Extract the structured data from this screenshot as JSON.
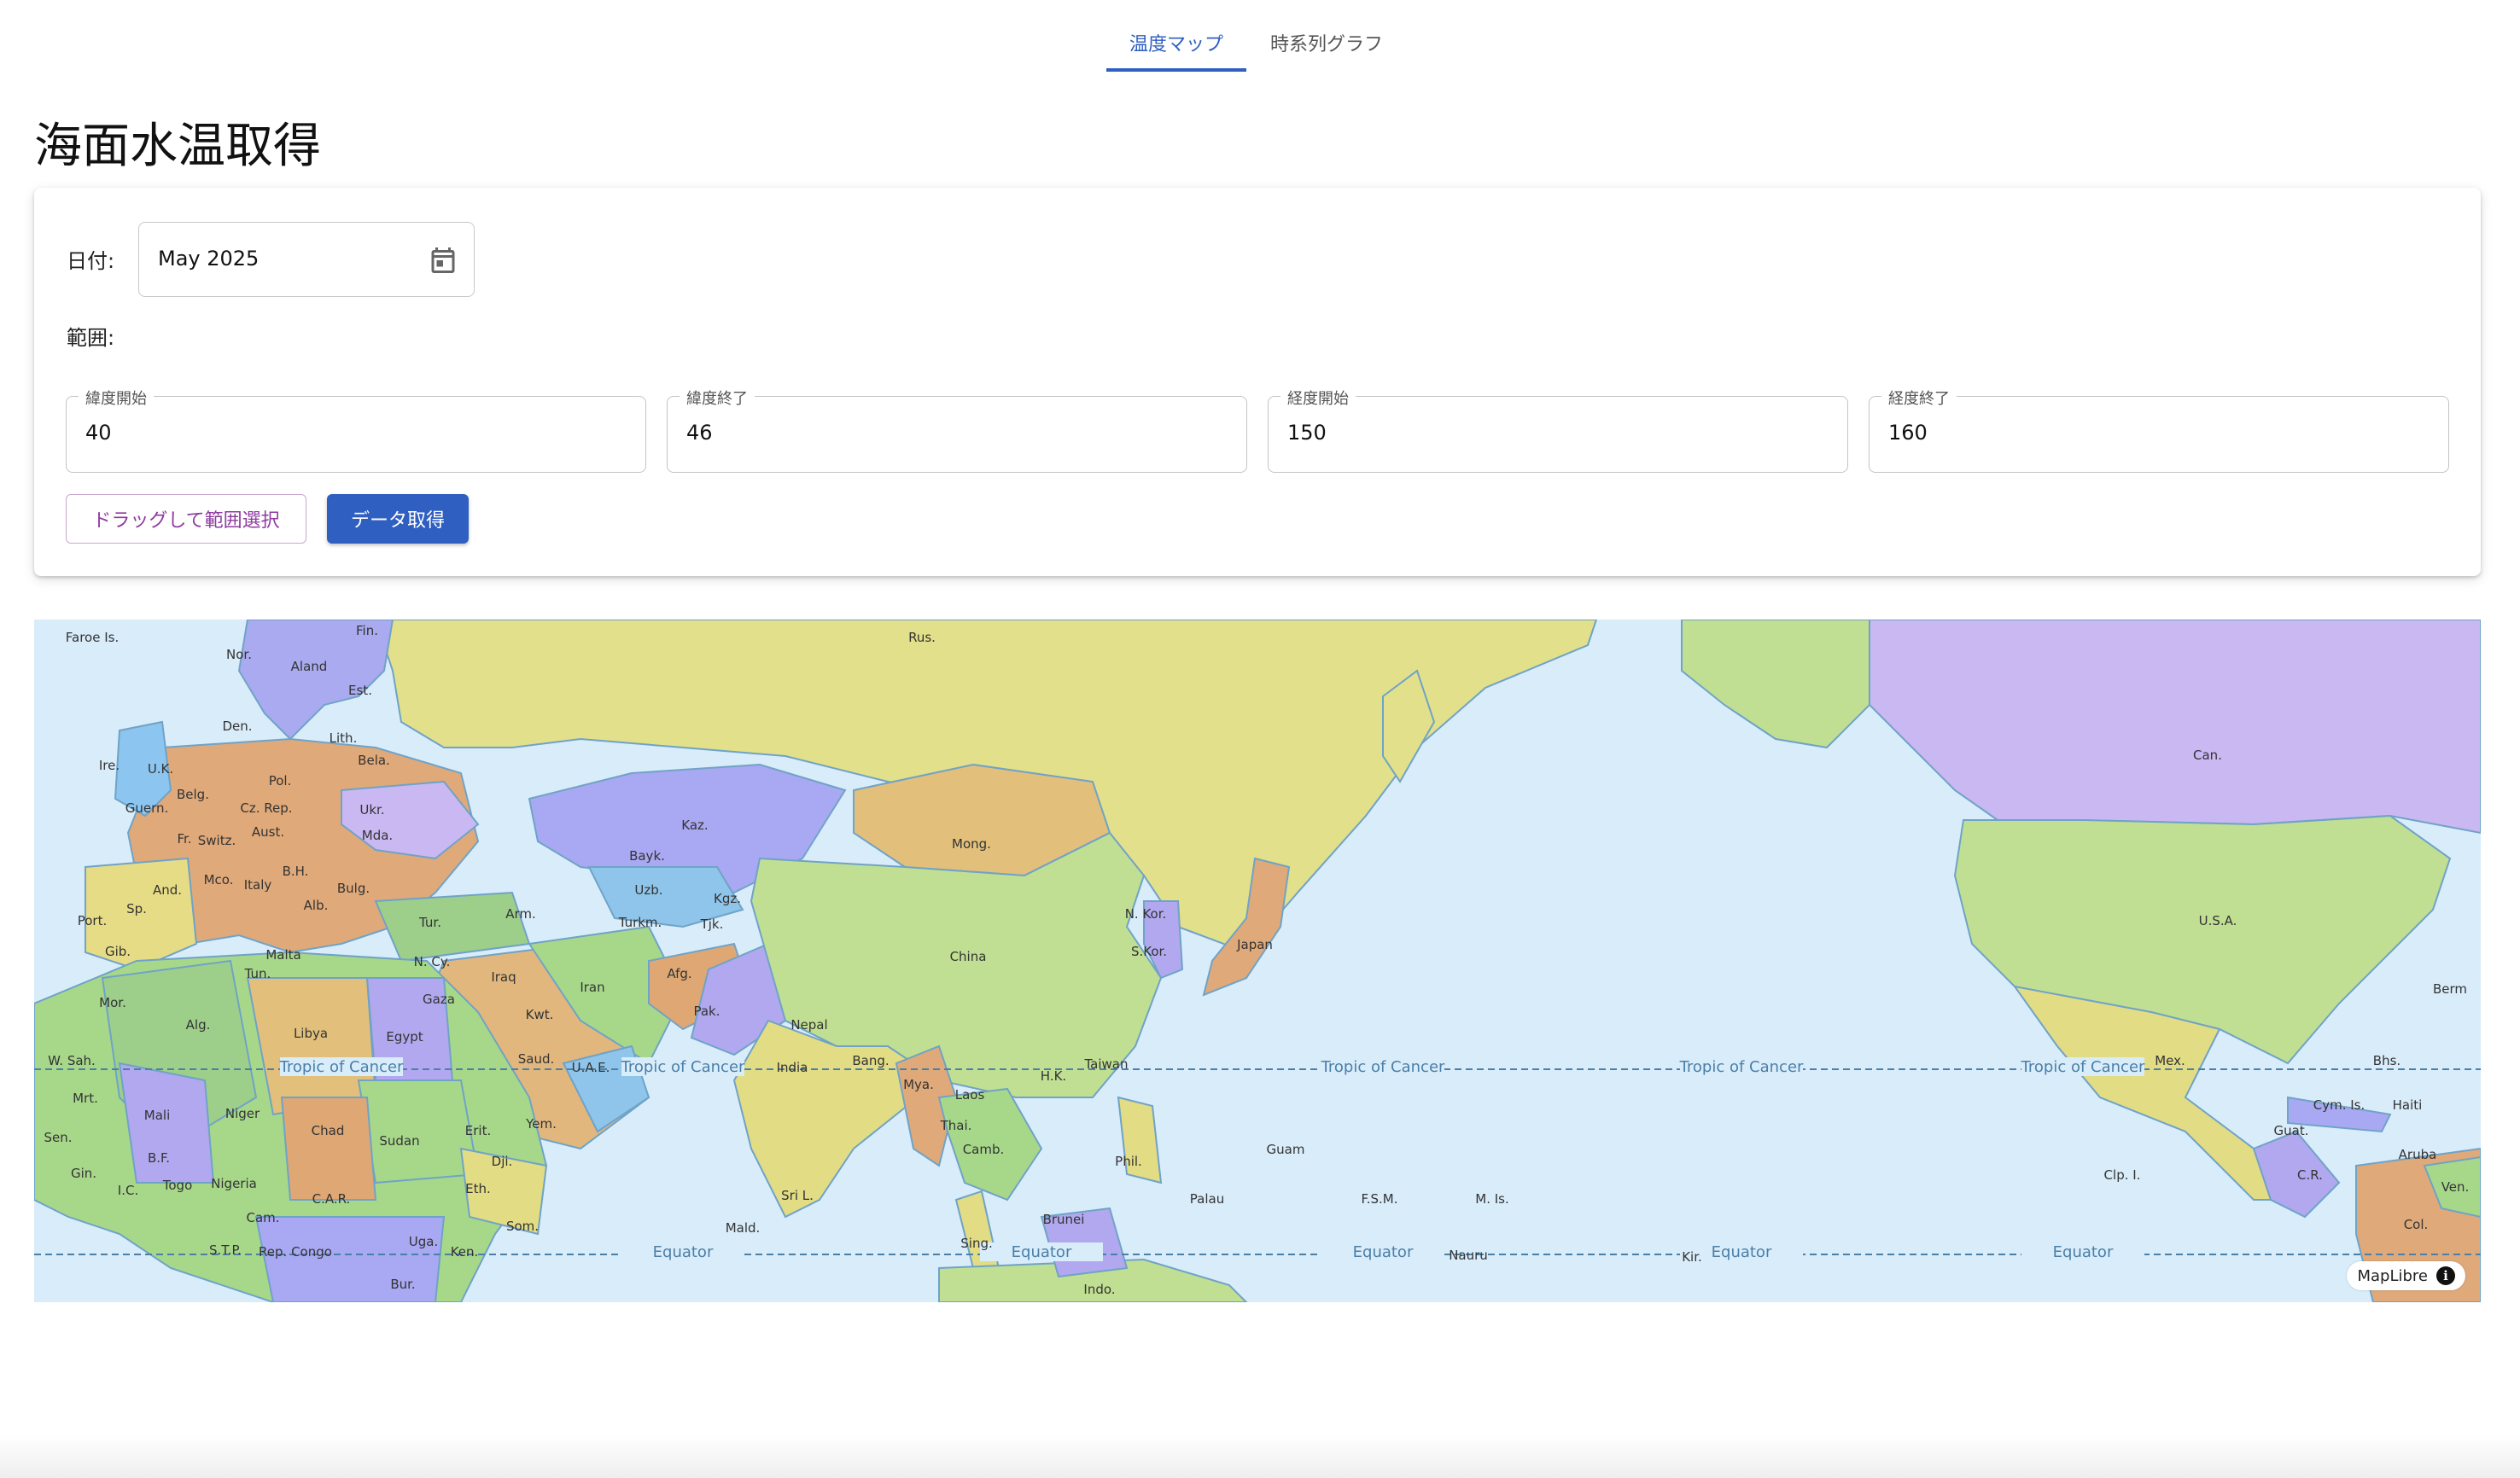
{
  "tabs": [
    {
      "label": "温度マップ",
      "active": true
    },
    {
      "label": "時系列グラフ",
      "active": false
    }
  ],
  "page_title": "海面水温取得",
  "form": {
    "date_label": "日付:",
    "date_value": "May 2025",
    "range_label": "範囲:",
    "fields": [
      {
        "label": "緯度開始",
        "value": "40"
      },
      {
        "label": "緯度終了",
        "value": "46"
      },
      {
        "label": "経度開始",
        "value": "150"
      },
      {
        "label": "経度終了",
        "value": "160"
      }
    ],
    "drag_button": "ドラッグして範囲選択",
    "fetch_button": "データ取得"
  },
  "map": {
    "attribution": "MapLibre",
    "lines": [
      "Tropic of Cancer",
      "Equator"
    ],
    "labels": [
      "Faroe Is.",
      "Nor.",
      "Fin.",
      "Aland",
      "Est.",
      "Rus.",
      "Den.",
      "Lith.",
      "Ire.",
      "U.K.",
      "Bela.",
      "Pol.",
      "Belg.",
      "Guern.",
      "Cz. Rep.",
      "Ukr.",
      "Fr.",
      "Switz.",
      "Aust.",
      "Mda.",
      "Kaz.",
      "Mong.",
      "Bayk.",
      "Sp.",
      "And.",
      "Mco.",
      "Italy",
      "B.H.",
      "Bulg.",
      "Uzb.",
      "Kgz.",
      "N. Kor.",
      "Port.",
      "Alb.",
      "Tur.",
      "Arm.",
      "Turkm.",
      "Tjk.",
      "S.Kor.",
      "Japan",
      "Gib.",
      "Malta",
      "N. Cy.",
      "Iraq",
      "Iran",
      "Afg.",
      "China",
      "Tun.",
      "Mor.",
      "Gaza",
      "Kwt.",
      "Pak.",
      "Nepal",
      "Alg.",
      "Libya",
      "Egypt",
      "Saud.",
      "U.A.E.",
      "India",
      "Bang.",
      "Taiwan",
      "H.K.",
      "W. Sah.",
      "Mya.",
      "Laos",
      "Mrt.",
      "Mali",
      "Niger",
      "Chad",
      "Sudan",
      "Erit.",
      "Yem.",
      "Thai.",
      "Camb.",
      "Sen.",
      "B.F.",
      "Dji.",
      "Phil.",
      "Guam",
      "Gin.",
      "I.C.",
      "Togo",
      "Nigeria",
      "C.A.R.",
      "Eth.",
      "Sri L.",
      "Palau",
      "F.S.M.",
      "M. Is.",
      "Cam.",
      "Som.",
      "Mald.",
      "Brunei",
      "S.T.P.",
      "Rep. Congo",
      "Uga.",
      "Ken.",
      "Sing.",
      "Nauru",
      "Kir.",
      "Bur.",
      "Indo.",
      "Can.",
      "U.S.A.",
      "Berm",
      "Mex.",
      "Bhs.",
      "Cym. Is.",
      "Haiti",
      "Guat.",
      "Aruba",
      "Clp. I.",
      "C.R.",
      "Ven.",
      "Col."
    ]
  }
}
